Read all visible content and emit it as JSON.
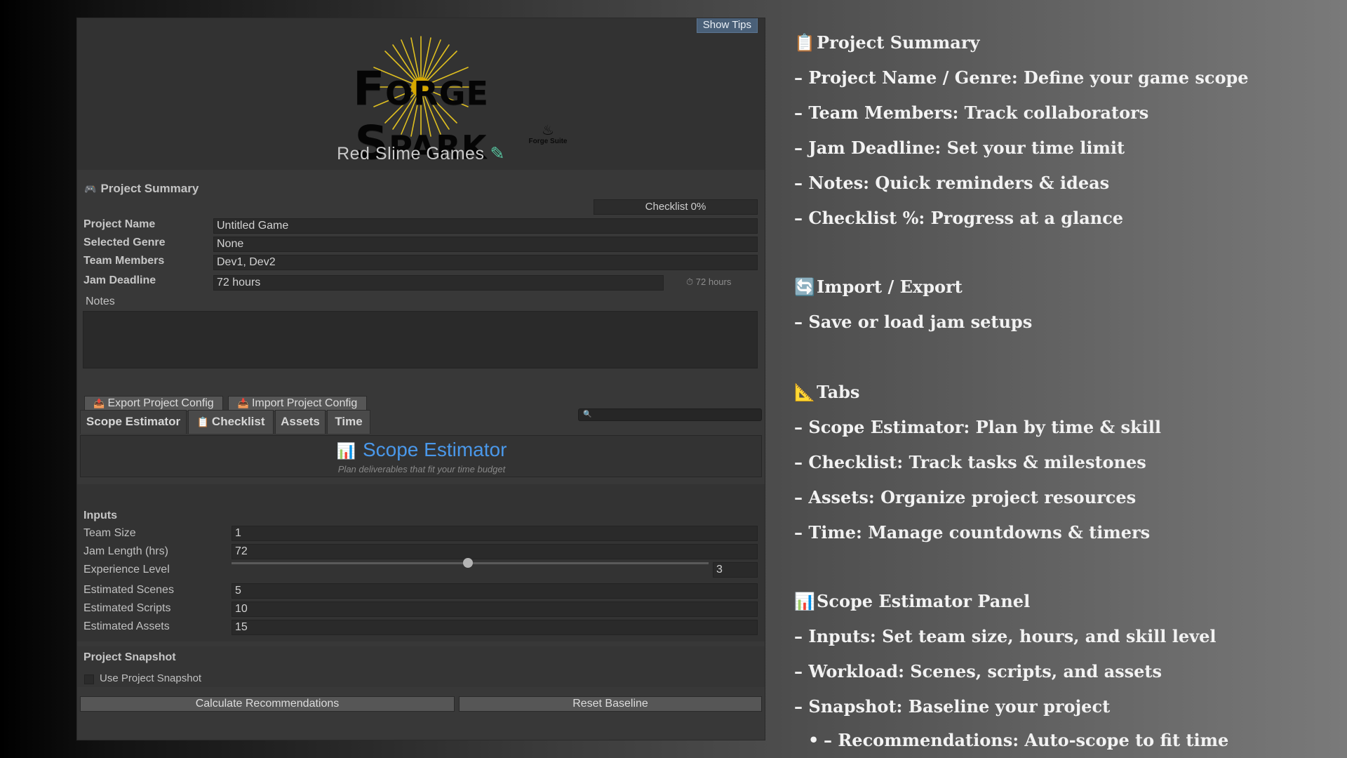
{
  "panel": {
    "show_tips": "Show Tips",
    "logo_text": "Forge Spark",
    "logo_mark": "Forge Suite",
    "studio": "Red Slime Games",
    "summary_title": "Project Summary",
    "checklist": "Checklist 0%",
    "fields": [
      {
        "label": "Project Name",
        "value": "Untitled Game"
      },
      {
        "label": "Selected Genre",
        "value": "None"
      },
      {
        "label": "Team Members",
        "value": "Dev1, Dev2"
      },
      {
        "label": "Jam Deadline",
        "value": "72 hours"
      }
    ],
    "deadline_hint": "72 hours",
    "notes_label": "Notes",
    "export_btn": "Export Project Config",
    "import_btn": "Import Project Config",
    "tabs": [
      "Scope Estimator",
      "Checklist",
      "Assets",
      "Time"
    ],
    "se_title": "Scope Estimator",
    "se_sub": "Plan deliverables that fit your time budget",
    "inputs_title": "Inputs",
    "inputs": [
      {
        "label": "Team Size",
        "value": "1"
      },
      {
        "label": "Jam Length (hrs)",
        "value": "72"
      },
      {
        "label": "Experience Level",
        "value": "3"
      },
      {
        "label": "Estimated Scenes",
        "value": "5"
      },
      {
        "label": "Estimated Scripts",
        "value": "10"
      },
      {
        "label": "Estimated Assets",
        "value": "15"
      }
    ],
    "snapshot_title": "Project Snapshot",
    "snapshot_check": "Use Project Snapshot",
    "calc_btn": "Calculate Recommendations",
    "reset_btn": "Reset Baseline"
  },
  "tips": [
    "Project Summary",
    "– Project Name / Genre: Define your game scope",
    "– Team Members: Track collaborators",
    "– Jam Deadline: Set your time limit",
    "– Notes: Quick reminders & ideas",
    "– Checklist %: Progress at a glance",
    "Import / Export",
    "– Save or load jam setups",
    "Tabs",
    "– Scope Estimator: Plan by time & skill",
    "– Checklist: Track tasks & milestones",
    "– Assets: Organize project resources",
    "– Time: Manage countdowns & timers",
    "Scope Estimator Panel",
    "– Inputs: Set team size, hours, and skill level",
    "– Workload: Scenes, scripts, and assets",
    "– Snapshot: Baseline your project",
    "– Recommendations: Auto-scope to fit time"
  ],
  "icons": {
    "clipboard": "clipboard-icon",
    "refresh": "refresh-icon",
    "ruler": "triangle-ruler-icon",
    "chart": "bar-chart-icon",
    "gamepad": "gamepad-icon",
    "pencil": "pencil-icon",
    "export": "export-icon",
    "import": "import-icon",
    "search": "search-icon",
    "timer": "timer-icon"
  },
  "slider": {
    "experience_level": 3
  },
  "colors": {
    "accent": "#4a98ea",
    "show_tips_bg": "#4a6078",
    "logo_rays": "#e0c020"
  }
}
